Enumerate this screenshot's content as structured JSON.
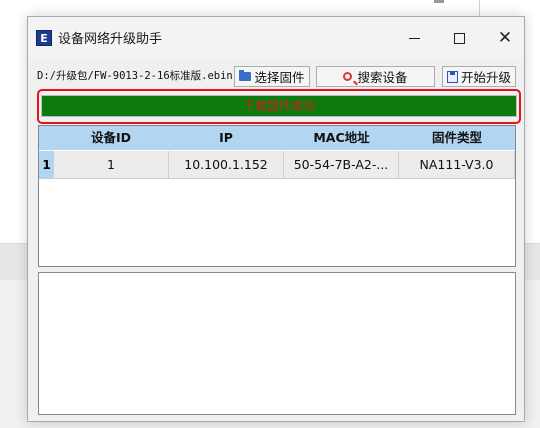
{
  "window": {
    "title": "设备网络升级助手",
    "icon_letter": "E"
  },
  "toolbar": {
    "firmware_path": "D:/升级包/FW-9013-2-16标准版.ebin",
    "select_firmware_label": "选择固件",
    "search_devices_label": "搜索设备",
    "start_upgrade_label": "开始升级"
  },
  "progress": {
    "text": "下载固件成功",
    "fraction": 1.0,
    "fill_color": "#0c7a0c",
    "text_color": "#cc2222"
  },
  "device_table": {
    "columns": [
      "设备ID",
      "IP",
      "MAC地址",
      "固件类型"
    ],
    "rows": [
      {
        "row_number": "1",
        "device_id": "1",
        "ip": "10.100.1.152",
        "mac": "50-54-7B-A2-...",
        "firmware_type": "NA111-V3.0"
      }
    ]
  },
  "log": {
    "text": ""
  },
  "colors": {
    "header_bg": "#b2d6f2",
    "highlight_border": "#e0141b"
  }
}
